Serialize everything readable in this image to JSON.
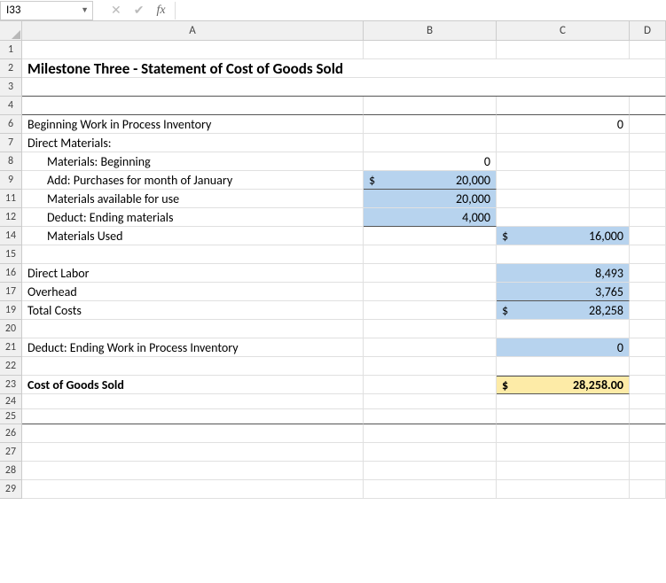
{
  "nameBox": "I33",
  "fxLabel": "fx",
  "cols": [
    "A",
    "B",
    "C",
    "D"
  ],
  "rows": [
    "1",
    "2",
    "3",
    "4",
    "6",
    "7",
    "8",
    "9",
    "11",
    "12",
    "14",
    "15",
    "16",
    "17",
    "19",
    "20",
    "21",
    "22",
    "23",
    "24",
    "25",
    "26",
    "27",
    "28",
    "29"
  ],
  "title": "Milestone Three - Statement of Cost of Goods Sold",
  "r6": {
    "a": "Beginning Work in Process Inventory",
    "c": "0"
  },
  "r7": {
    "a": "Direct Materials:"
  },
  "r8": {
    "a": "Materials: Beginning",
    "b": "0"
  },
  "r9": {
    "a": "Add: Purchases for month of January",
    "b_sym": "$",
    "b": "20,000"
  },
  "r11": {
    "a": "Materials available for use",
    "b": "20,000"
  },
  "r12": {
    "a": "Deduct: Ending materials",
    "b": "4,000"
  },
  "r14": {
    "a": "Materials Used",
    "c_sym": "$",
    "c": "16,000"
  },
  "r16": {
    "a": "Direct Labor",
    "c": "8,493"
  },
  "r17": {
    "a": "Overhead",
    "c": "3,765"
  },
  "r19": {
    "a": "Total Costs",
    "c_sym": "$",
    "c": "28,258"
  },
  "r21": {
    "a": "Deduct: Ending Work in Process Inventory",
    "c": "0"
  },
  "r23": {
    "a": "Cost of Goods Sold",
    "c_sym": "$",
    "c": "28,258.00"
  }
}
